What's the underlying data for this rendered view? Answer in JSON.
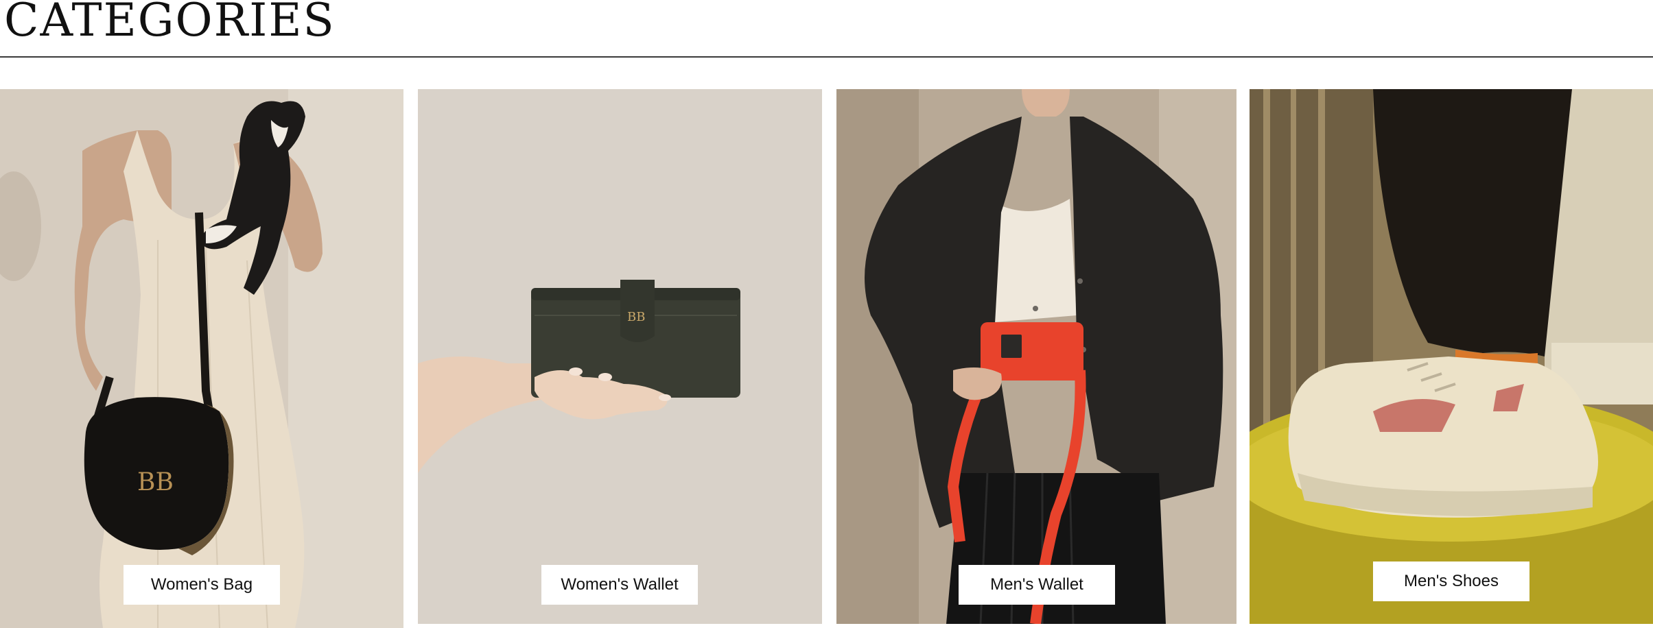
{
  "page": {
    "title": "CATEGORIES"
  },
  "categories": [
    {
      "label": "Women's Bag",
      "icon": "womens-bag-photo"
    },
    {
      "label": "Women's Wallet",
      "icon": "womens-wallet-photo"
    },
    {
      "label": "Men's Wallet",
      "icon": "mens-wallet-photo"
    },
    {
      "label": "Men's Shoes",
      "icon": "mens-shoes-photo"
    }
  ],
  "colors": {
    "text": "#111111",
    "divider": "#3a3a3a",
    "label_background": "#ffffff",
    "bag_black": "#141210",
    "wallet_green": "#3a3d33",
    "wallet_background": "#d9d2c9",
    "bag_red": "#e8432c",
    "stool_yellow": "#c9b82a"
  }
}
